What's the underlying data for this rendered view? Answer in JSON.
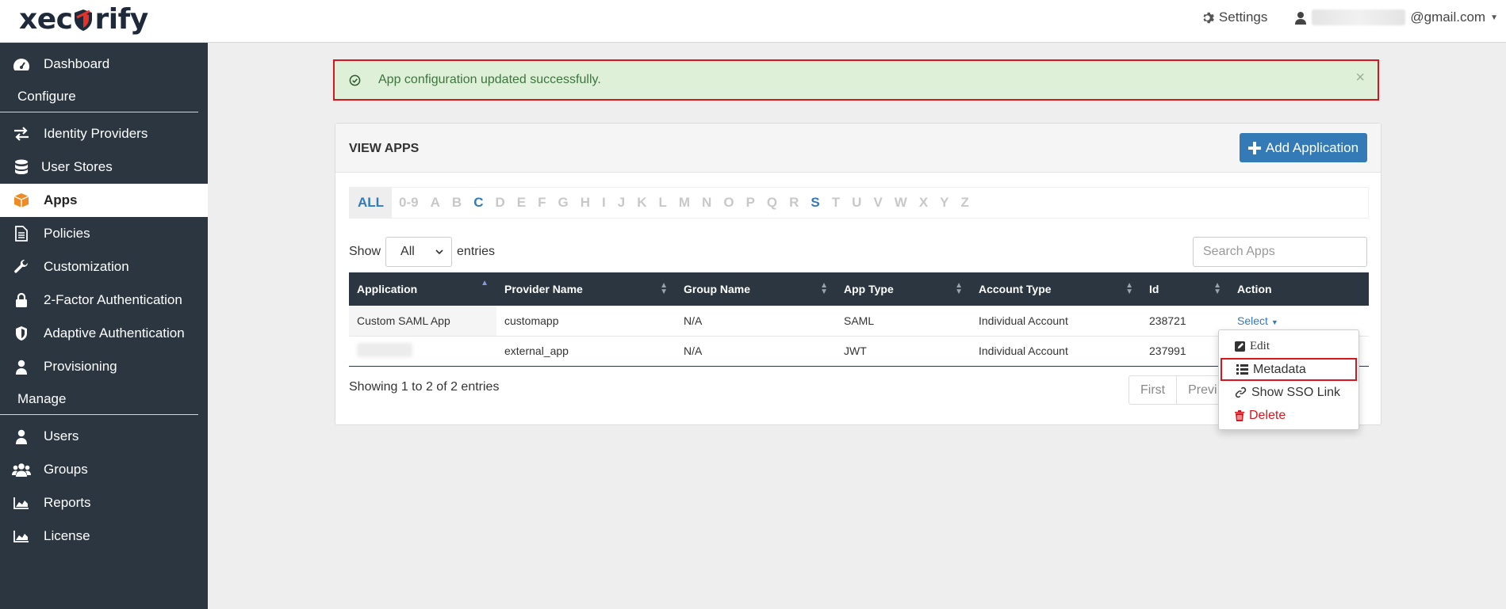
{
  "header": {
    "logo_text_left": "xec",
    "logo_text_right": "rify",
    "settings_label": "Settings",
    "user_email_suffix": "@gmail.com"
  },
  "sidebar": {
    "items": [
      {
        "label": "Dashboard",
        "icon": "dashboard-icon"
      },
      {
        "section": "Configure"
      },
      {
        "label": "Identity Providers",
        "icon": "exchange-icon"
      },
      {
        "label": "User Stores",
        "icon": "database-icon"
      },
      {
        "label": "Apps",
        "icon": "cube-icon",
        "active": true
      },
      {
        "label": "Policies",
        "icon": "document-icon"
      },
      {
        "label": "Customization",
        "icon": "wrench-icon"
      },
      {
        "label": "2-Factor Authentication",
        "icon": "lock-icon"
      },
      {
        "label": "Adaptive Authentication",
        "icon": "shield-icon"
      },
      {
        "label": "Provisioning",
        "icon": "user-icon"
      },
      {
        "section": "Manage"
      },
      {
        "label": "Users",
        "icon": "user-icon"
      },
      {
        "label": "Groups",
        "icon": "users-icon"
      },
      {
        "label": "Reports",
        "icon": "area-chart-icon"
      },
      {
        "label": "License",
        "icon": "area-chart-icon"
      }
    ]
  },
  "alert": {
    "message": "App configuration updated successfully.",
    "close": "×"
  },
  "panel": {
    "title": "VIEW APPS",
    "add_button": "Add Application"
  },
  "alpha_filter": [
    "ALL",
    "0-9",
    "A",
    "B",
    "C",
    "D",
    "E",
    "F",
    "G",
    "H",
    "I",
    "J",
    "K",
    "L",
    "M",
    "N",
    "O",
    "P",
    "Q",
    "R",
    "S",
    "T",
    "U",
    "V",
    "W",
    "X",
    "Y",
    "Z"
  ],
  "alpha_enabled": [
    "ALL",
    "C",
    "S"
  ],
  "length": {
    "show_label": "Show",
    "value": "All",
    "entries_label": "entries"
  },
  "search": {
    "placeholder": "Search Apps"
  },
  "table": {
    "headers": [
      "Application",
      "Provider Name",
      "Group Name",
      "App Type",
      "Account Type",
      "Id",
      "Action"
    ],
    "rows": [
      {
        "application": "Custom SAML App",
        "provider": "customapp",
        "group": "N/A",
        "type": "SAML",
        "account": "Individual Account",
        "id": "238721",
        "action": "Select"
      },
      {
        "application": "",
        "provider": "external_app",
        "group": "N/A",
        "type": "JWT",
        "account": "Individual Account",
        "id": "237991",
        "action": ""
      }
    ]
  },
  "info": "Showing 1 to 2 of 2 entries",
  "pager": {
    "first": "First",
    "previous": "Previ"
  },
  "dropdown": {
    "edit": "Edit",
    "metadata": "Metadata",
    "sso": "Show SSO Link",
    "delete": "Delete"
  },
  "colors": {
    "sidebar_bg": "#2b3640",
    "primary": "#337ab7",
    "success_bg": "#dff0d8",
    "highlight": "#d9161e"
  }
}
